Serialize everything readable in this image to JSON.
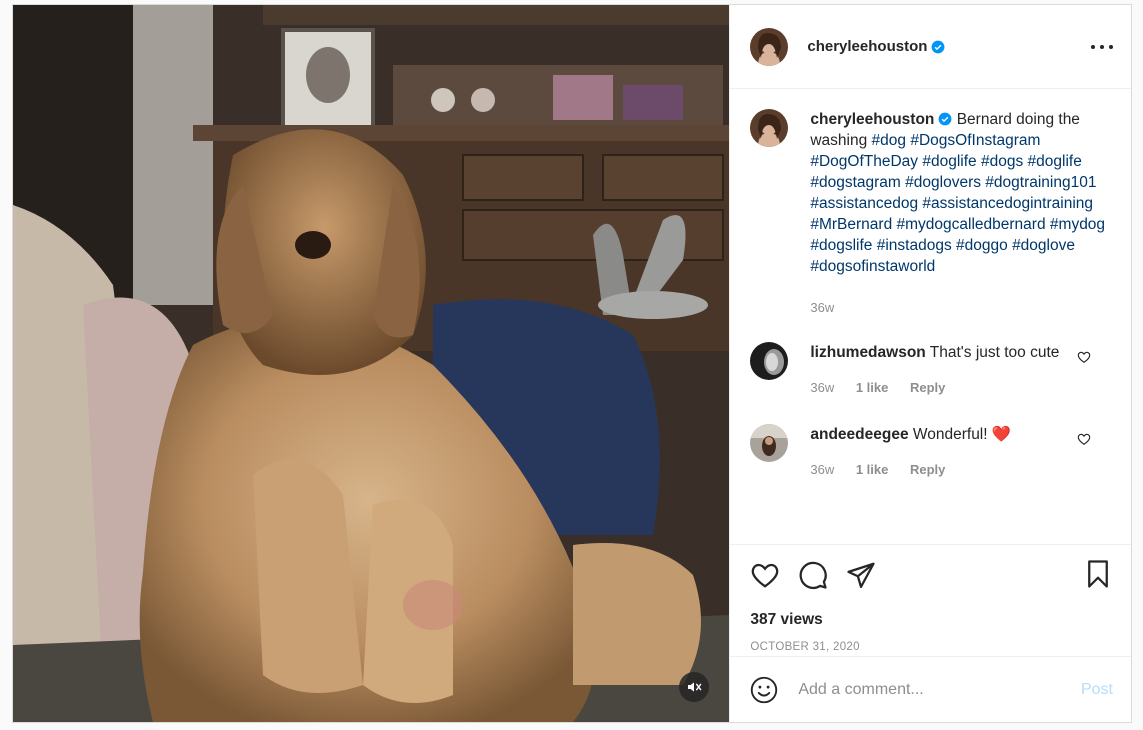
{
  "post": {
    "username": "cheryleehouston",
    "views_label": "387 views",
    "date": "OCTOBER 31, 2020"
  },
  "caption": {
    "username": "cheryleehouston",
    "text": "Bernard doing the washing",
    "hashtags": [
      "#dog",
      "#DogsOfInstagram",
      "#DogOfTheDay",
      "#doglife",
      "#dogs",
      "#doglife",
      "#dogstagram",
      "#doglovers",
      "#dogtraining101",
      "#assistancedog",
      "#assistancedogintraining",
      "#MrBernard",
      "#mydogcalledbernard",
      "#mydog",
      "#dogslife",
      "#instadogs",
      "#doggo",
      "#doglove",
      "#dogsofinstaworld"
    ],
    "age": "36w"
  },
  "comments": [
    {
      "username": "lizhumedawson",
      "text": "That's just too cute",
      "age": "36w",
      "likes": "1 like",
      "reply": "Reply"
    },
    {
      "username": "andeedeegee",
      "text": "Wonderful! ❤️",
      "age": "36w",
      "likes": "1 like",
      "reply": "Reply"
    }
  ],
  "add_comment": {
    "placeholder": "Add a comment...",
    "post_label": "Post"
  },
  "icons": {
    "verified": "verified-badge-icon",
    "more": "more-options-icon",
    "like": "heart-icon",
    "comment": "comment-icon",
    "share": "share-icon",
    "save": "bookmark-icon",
    "emoji": "emoji-icon",
    "mute": "muted-speaker-icon"
  },
  "colors": {
    "accent": "#0095f6",
    "hashtag": "#00376b",
    "muted": "#8e8e8e",
    "post_disabled": "#b2dffc"
  }
}
